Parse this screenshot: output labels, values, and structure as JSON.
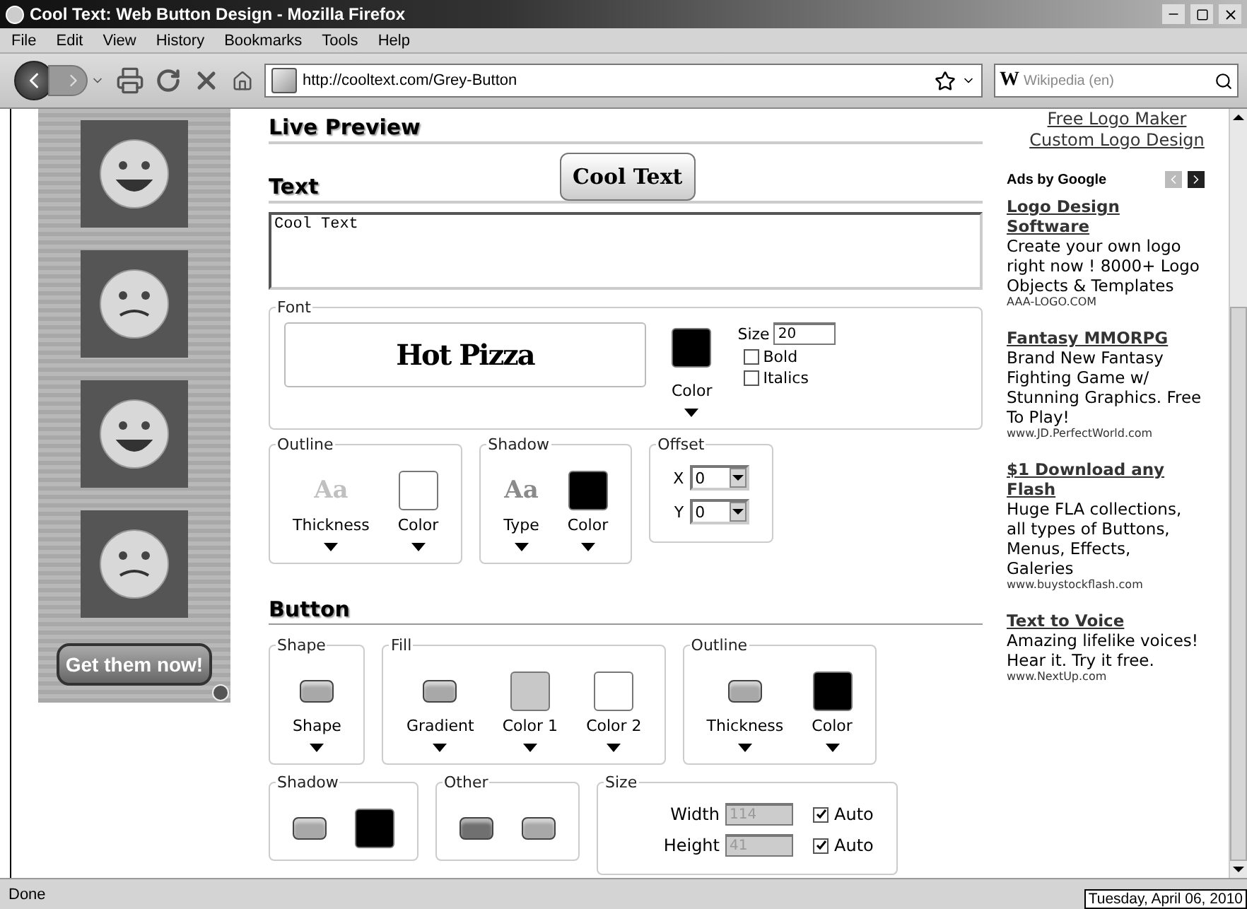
{
  "window": {
    "title": "Cool Text: Web Button Design - Mozilla Firefox"
  },
  "menu": [
    "File",
    "Edit",
    "View",
    "History",
    "Bookmarks",
    "Tools",
    "Help"
  ],
  "toolbar": {
    "url": "http://cooltext.com/Grey-Button",
    "search_engine": "W",
    "search_placeholder": "Wikipedia (en)"
  },
  "left_ad": {
    "button": "Get them now!"
  },
  "main": {
    "live_preview": {
      "heading": "Live Preview",
      "preview_button": "Cool Text"
    },
    "text_section": {
      "heading": "Text",
      "value": "Cool Text"
    },
    "font": {
      "legend": "Font",
      "font_preview": "Hot Pizza",
      "color_label": "Color",
      "color": "#000000",
      "size_label": "Size",
      "size": "20",
      "options": [
        {
          "label": "Bold",
          "checked": false
        },
        {
          "label": "Italics",
          "checked": false
        }
      ]
    },
    "text_groups": [
      {
        "kind": "controls",
        "legend": "Outline",
        "controls": [
          {
            "kind": "glyph",
            "glyph": "Aa",
            "color": "#c0c0c0",
            "label": "Thickness"
          },
          {
            "kind": "swatch",
            "color": "#ffffff",
            "label": "Color"
          }
        ]
      },
      {
        "kind": "controls",
        "legend": "Shadow",
        "controls": [
          {
            "kind": "glyph",
            "glyph": "Aa",
            "color": "#8a8a8a",
            "label": "Type"
          },
          {
            "kind": "swatch",
            "color": "#000000",
            "label": "Color"
          }
        ]
      },
      {
        "kind": "offset",
        "legend": "Offset",
        "fields": [
          {
            "label": "X",
            "value": "0"
          },
          {
            "label": "Y",
            "value": "0"
          }
        ]
      }
    ],
    "button": {
      "heading": "Button",
      "rows": [
        [
          {
            "kind": "controls",
            "legend": "Shape",
            "controls": [
              {
                "kind": "shape",
                "color": "#a8a8a8",
                "label": "Shape"
              }
            ]
          },
          {
            "kind": "controls",
            "legend": "Fill",
            "controls": [
              {
                "kind": "shape",
                "color": "#a8a8a8",
                "label": "Gradient"
              },
              {
                "kind": "swatch",
                "color": "#c8c8c8",
                "label": "Color 1"
              },
              {
                "kind": "swatch",
                "color": "#ffffff",
                "label": "Color 2"
              }
            ]
          },
          {
            "kind": "controls",
            "legend": "Outline",
            "controls": [
              {
                "kind": "shape",
                "color": "#a8a8a8",
                "label": "Thickness"
              },
              {
                "kind": "swatch",
                "color": "#000000",
                "label": "Color"
              }
            ]
          }
        ],
        [
          {
            "kind": "controls",
            "legend": "Shadow",
            "controls": [
              {
                "kind": "shape",
                "color": "#a8a8a8"
              },
              {
                "kind": "swatch",
                "color": "#000000"
              }
            ]
          },
          {
            "kind": "controls",
            "legend": "Other",
            "controls": [
              {
                "kind": "shape",
                "color": "#707070"
              },
              {
                "kind": "shape",
                "color": "#a8a8a8"
              }
            ]
          },
          {
            "kind": "size",
            "legend": "Size",
            "fields": [
              {
                "label": "Width",
                "value": "114",
                "disabled": true,
                "auto_label": "Auto",
                "auto": true
              },
              {
                "label": "Height",
                "value": "41",
                "disabled": true,
                "auto_label": "Auto",
                "auto": true
              }
            ]
          }
        ]
      ]
    }
  },
  "right": {
    "links": [
      "Free Logo Maker",
      "Custom Logo Design"
    ],
    "ads_label": "Ads by Google",
    "ads": [
      {
        "title": "Logo Design Software",
        "body": "Create your own logo right now ! 8000+ Logo Objects & Templates",
        "url": "AAA-LOGO.COM"
      },
      {
        "title": "Fantasy MMORPG",
        "body": "Brand New Fantasy Fighting Game w/ Stunning Graphics. Free To Play!",
        "url": "www.JD.PerfectWorld.com"
      },
      {
        "title": "$1 Download any Flash",
        "body": "Huge FLA collections, all types of Buttons, Menus, Effects, Galeries",
        "url": "www.buystockflash.com"
      },
      {
        "title": "Text to Voice",
        "body": "Amazing lifelike voices! Hear it. Try it free.",
        "url": "www.NextUp.com"
      }
    ]
  },
  "status_bar": {
    "text": "Done",
    "tooltip": "Tuesday, April 06, 2010"
  }
}
